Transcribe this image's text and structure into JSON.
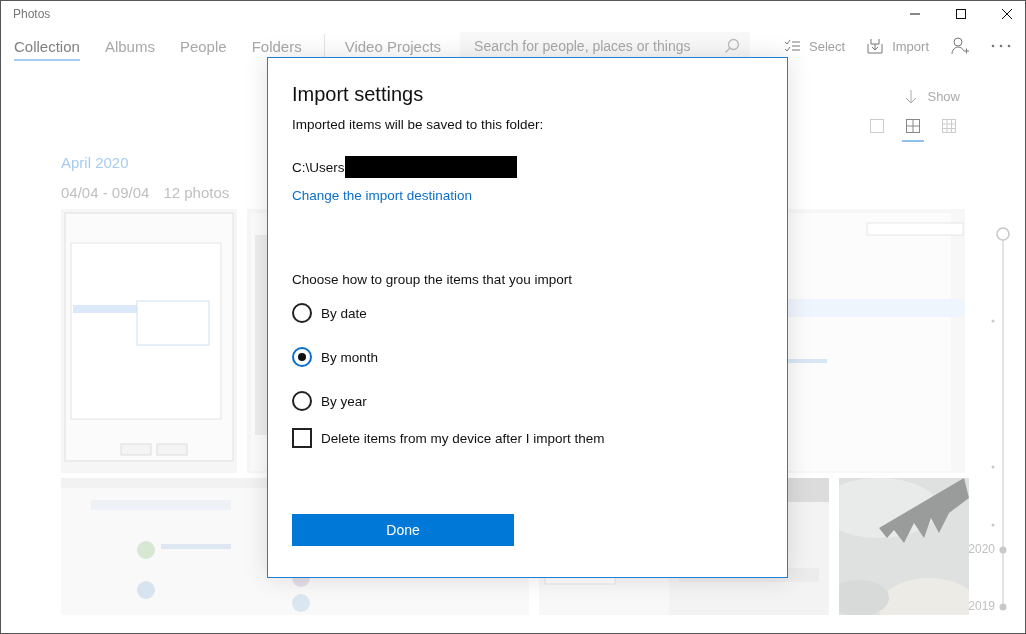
{
  "window": {
    "title": "Photos"
  },
  "nav": {
    "tabs": [
      {
        "label": "Collection",
        "selected": true
      },
      {
        "label": "Albums",
        "selected": false
      },
      {
        "label": "People",
        "selected": false
      },
      {
        "label": "Folders",
        "selected": false
      },
      {
        "label": "Video Projects",
        "selected": false
      }
    ],
    "search": {
      "placeholder": "Search for people, places or things"
    },
    "actions": [
      {
        "kind": "select",
        "label": "Select"
      },
      {
        "kind": "import",
        "label": "Import"
      },
      {
        "kind": "person"
      },
      {
        "kind": "more"
      }
    ]
  },
  "view": {
    "show": "Show",
    "sizes": [
      {
        "kind": "large",
        "selected": false
      },
      {
        "kind": "medium",
        "selected": true
      },
      {
        "kind": "small",
        "selected": false
      }
    ]
  },
  "group": {
    "title": "April 2020",
    "range": "04/04 - 09/04",
    "count": "12 photos"
  },
  "timeline": {
    "years": [
      "2020",
      "2019"
    ]
  },
  "dialog": {
    "title": "Import settings",
    "folder_label": "Imported items will be saved to this folder:",
    "path": "C:\\Users",
    "link": "Change the import destination",
    "prompt": "Choose how to group the items that you import",
    "options": [
      {
        "label": "By date",
        "selected": false
      },
      {
        "label": "By month",
        "selected": true
      },
      {
        "label": "By year",
        "selected": false
      }
    ],
    "delete_option": {
      "label": "Delete items from my device after I import them",
      "checked": false
    },
    "done": "Done"
  }
}
